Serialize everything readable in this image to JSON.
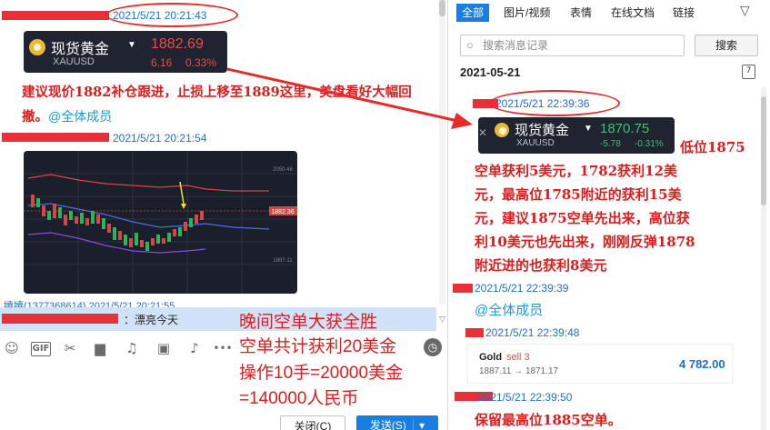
{
  "left": {
    "msg1": {
      "timestamp": "2021/5/21 20:21:43",
      "quote": {
        "name": "现货黄金",
        "symbol": "XAUUSD",
        "price": "1882.69",
        "change": "6.16",
        "change_pct": "0.33%"
      },
      "text": "建议现价1882补仓跟进，止损上移至1889这里，美盘看好大幅回撤。",
      "mention": "@全体成员"
    },
    "msg2": {
      "timestamp": "2021/5/21 20:21:54",
      "chart_price_label": "1882.36",
      "chart_top_label": "2050.46",
      "chart_low_label": "1887.11"
    },
    "msg3": {
      "timestamp": "2021/5/21 20:21:55",
      "sender_partial": "嬉嬉(1377368614)"
    },
    "input": {
      "text": "：漂亮今天"
    },
    "overlay": {
      "line1": "晚间空单大获全胜",
      "line2": "空单共计获利20美金",
      "line3": "操作10手=20000美金",
      "line4": "=140000人民币"
    },
    "toolbar": {
      "emoji": "emoji-icon",
      "gif": "GIF",
      "scissors": "scissors-icon",
      "folder": "folder-icon",
      "music": "music-icon",
      "image": "image-icon",
      "bell": "bell-icon",
      "more": "•••",
      "clock": "clock-icon"
    },
    "buttons": {
      "close": "关闭(C)",
      "send": "发送(S)"
    }
  },
  "right": {
    "tabs": [
      "全部",
      "图片/视频",
      "表情",
      "在线文档",
      "链接"
    ],
    "active_tab": "全部",
    "search_placeholder": "搜索消息记录",
    "search_button": "搜索",
    "date": "2021-05-21",
    "msg1": {
      "timestamp": "2021/5/21 22:39:36",
      "quote": {
        "name": "现货黄金",
        "symbol": "XAUUSD",
        "price": "1870.75",
        "change": "-5.78",
        "change_pct": "-0.31%"
      },
      "text_lines": [
        "低位1875",
        "空单获利5美元，1782获利12美",
        "元，最高位1785附近的获利15美",
        "元，建议1875空单先出来，高位获",
        "利10美元也先出来，刚刚反弹1878",
        "附近进的也获利8美元"
      ]
    },
    "msg2": {
      "timestamp": "2021/5/21 22:39:39",
      "mention": "@全体成员"
    },
    "msg3": {
      "timestamp": "2021/5/21 22:39:48",
      "card": {
        "symbol": "Gold",
        "side": "sell 3",
        "range": "1887.11 → 1871.17",
        "profit": "4 782.00"
      }
    },
    "msg4": {
      "timestamp": "2021/5/21 22:39:50",
      "text": "保留最高位1885空单。"
    }
  },
  "colors": {
    "accent": "#1a7ee0",
    "alert_red": "#e01b1b",
    "timestamp_blue": "#1e6fd9",
    "gain_red": "#e84a4a",
    "gain_green": "#3fbf6f"
  }
}
